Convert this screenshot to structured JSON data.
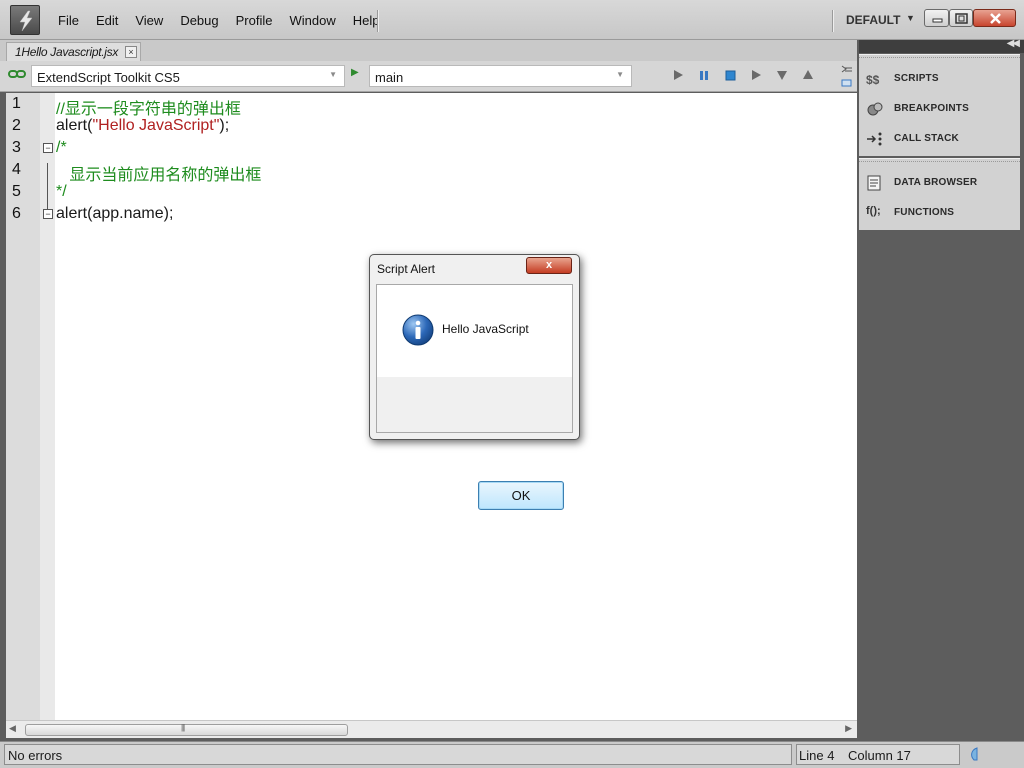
{
  "menu": {
    "items": [
      "File",
      "Edit",
      "View",
      "Debug",
      "Profile",
      "Window",
      "Help"
    ],
    "workspace": "DEFAULT"
  },
  "window_controls": {
    "minimize_icon": "minimize-icon",
    "maximize_icon": "maximize-icon",
    "close_icon": "close-icon"
  },
  "document_tab": {
    "label": "1Hello Javascript.jsx",
    "close": "×"
  },
  "toolbar": {
    "target_app": "ExtendScript Toolkit CS5",
    "engine": "main",
    "icons": [
      "run-icon",
      "pause-icon",
      "stop-icon",
      "step-over-icon",
      "step-into-icon",
      "step-out-icon"
    ]
  },
  "editor": {
    "line_numbers": [
      "1",
      "2",
      "3",
      "4",
      "5",
      "6"
    ],
    "line1_comment": "//显示一段字符串的弹出框",
    "line2_prefix": "alert(",
    "line2_string": "\"Hello JavaScript\"",
    "line2_suffix": ");",
    "line3": "/*",
    "line4": "   显示当前应用名称的弹出框",
    "line5": "*/",
    "line6": "alert(app.name);"
  },
  "statusbar": {
    "message": "No errors",
    "line": "Line 4",
    "column": "Column 17"
  },
  "panel": {
    "group1": [
      {
        "label": "SCRIPTS",
        "icon": "scripts-icon"
      },
      {
        "label": "BREAKPOINTS",
        "icon": "breakpoints-icon"
      },
      {
        "label": "CALL STACK",
        "icon": "call-stack-icon"
      }
    ],
    "group2": [
      {
        "label": "DATA BROWSER",
        "icon": "data-browser-icon"
      },
      {
        "label": "FUNCTIONS",
        "icon": "functions-icon",
        "glyph": "f();"
      }
    ]
  },
  "dialog": {
    "title": "Script Alert",
    "message": "Hello JavaScript",
    "ok_label": "OK",
    "close_glyph": "x"
  },
  "colors": {
    "comment": "#1e8c1e",
    "string": "#b02121",
    "panel_bg": "#5d5d5d"
  }
}
